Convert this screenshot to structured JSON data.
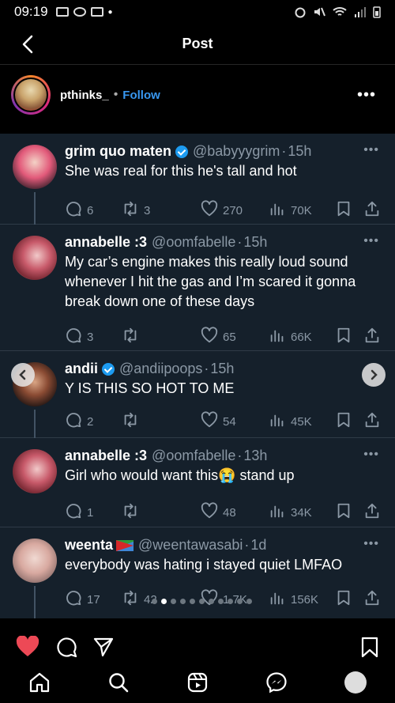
{
  "status_bar": {
    "time": "09:19"
  },
  "header": {
    "title": "Post"
  },
  "author": {
    "username": "pthinks_",
    "separator": "•",
    "follow_label": "Follow"
  },
  "tweets": [
    {
      "name": "grim quo maten",
      "handle": "@babyyygrim",
      "time": "15h",
      "verified": true,
      "text": "She was real for this he's tall and hot",
      "replies": "6",
      "retweets": "3",
      "likes": "270",
      "views": "70K"
    },
    {
      "name": "annabelle :3",
      "handle": "@oomfabelle",
      "time": "15h",
      "verified": false,
      "text": "My car’s engine makes this really loud sound whenever I hit the gas and I’m scared it gonna break down one of these days",
      "replies": "3",
      "retweets": "",
      "likes": "65",
      "views": "66K"
    },
    {
      "name": "andii",
      "handle": "@andiipoops",
      "time": "15h",
      "verified": true,
      "text": "Y IS THIS SO HOT TO ME",
      "replies": "2",
      "retweets": "",
      "likes": "54",
      "views": "45K"
    },
    {
      "name": "annabelle :3",
      "handle": "@oomfabelle",
      "time": "13h",
      "verified": false,
      "text": "Girl who would want this",
      "text_after": " stand up",
      "emoji": "😭",
      "replies": "1",
      "retweets": "",
      "likes": "48",
      "views": "34K"
    },
    {
      "name": "weenta",
      "handle": "@weentawasabi",
      "time": "1d",
      "verified": false,
      "text": "everybody was hating i stayed quiet LMFAO",
      "replies": "17",
      "retweets": "42",
      "likes": "1.7K",
      "views": "156K"
    }
  ],
  "carousel": {
    "count": 11,
    "active": 1
  },
  "colors": {
    "card_bg": "#15202b",
    "muted": "#8b98a5",
    "accent": "#1d9bf0",
    "follow": "#3897f0",
    "like_red": "#ed4956"
  }
}
